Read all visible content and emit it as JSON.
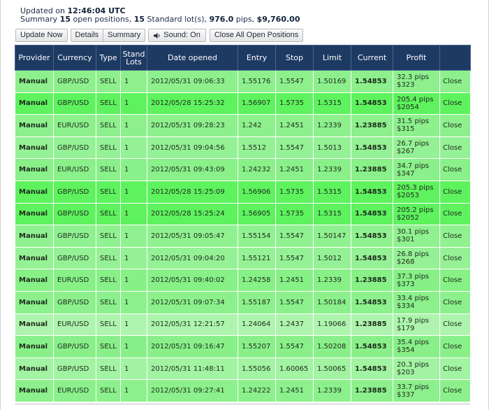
{
  "header": {
    "updated_prefix": "Updated on",
    "updated_time": "12:46:04 UTC",
    "summary_prefix": "Summary",
    "open_positions_count": "15",
    "open_positions_text": "open positions,",
    "standard_lots_count": "15",
    "standard_lots_text": "Standard lot(s),",
    "pips_total": "976.0",
    "pips_text": "pips,",
    "money_total": "$9,760.00"
  },
  "toolbar": {
    "update_now_label": "Update Now",
    "details_label": "Details",
    "summary_label": "Summary",
    "sound_label": "Sound: On",
    "close_all_label": "Close All Open Positions"
  },
  "table": {
    "columns": [
      "Provider",
      "Currency",
      "Type",
      "Stand Lots",
      "Date opened",
      "Entry",
      "Stop",
      "Limit",
      "Current",
      "Profit",
      ""
    ],
    "rows": [
      {
        "provider": "Manual",
        "currency": "GBP/USD",
        "type": "SELL",
        "lots": "1",
        "date": "2012/05/31 09:06:33",
        "entry": "1.55176",
        "stop": "1.5547",
        "limit": "1.50169",
        "current": "1.54853",
        "profit_pips": "32.3 pips",
        "profit_money": "$323",
        "action": "Close",
        "color": "#8df08d"
      },
      {
        "provider": "Manual",
        "currency": "GBP/USD",
        "type": "SELL",
        "lots": "1",
        "date": "2012/05/28 15:25:32",
        "entry": "1.56907",
        "stop": "1.5735",
        "limit": "1.5315",
        "current": "1.54853",
        "profit_pips": "205.4 pips",
        "profit_money": "$2054",
        "action": "Close",
        "color": "#5ef25e"
      },
      {
        "provider": "Manual",
        "currency": "EUR/USD",
        "type": "SELL",
        "lots": "1",
        "date": "2012/05/31 09:28:23",
        "entry": "1.242",
        "stop": "1.2451",
        "limit": "1.2339",
        "current": "1.23885",
        "profit_pips": "31.5 pips",
        "profit_money": "$315",
        "action": "Close",
        "color": "#8df08d"
      },
      {
        "provider": "Manual",
        "currency": "GBP/USD",
        "type": "SELL",
        "lots": "1",
        "date": "2012/05/31 09:04:56",
        "entry": "1.5512",
        "stop": "1.5547",
        "limit": "1.5013",
        "current": "1.54853",
        "profit_pips": "26.7 pips",
        "profit_money": "$267",
        "action": "Close",
        "color": "#95f195"
      },
      {
        "provider": "Manual",
        "currency": "EUR/USD",
        "type": "SELL",
        "lots": "1",
        "date": "2012/05/31 09:43:09",
        "entry": "1.24232",
        "stop": "1.2451",
        "limit": "1.2339",
        "current": "1.23885",
        "profit_pips": "34.7 pips",
        "profit_money": "$347",
        "action": "Close",
        "color": "#8af08a"
      },
      {
        "provider": "Manual",
        "currency": "GBP/USD",
        "type": "SELL",
        "lots": "1",
        "date": "2012/05/28 15:25:09",
        "entry": "1.56906",
        "stop": "1.5735",
        "limit": "1.5315",
        "current": "1.54853",
        "profit_pips": "205.3 pips",
        "profit_money": "$2053",
        "action": "Close",
        "color": "#5ef25e"
      },
      {
        "provider": "Manual",
        "currency": "GBP/USD",
        "type": "SELL",
        "lots": "1",
        "date": "2012/05/28 15:25:24",
        "entry": "1.56905",
        "stop": "1.5735",
        "limit": "1.5315",
        "current": "1.54853",
        "profit_pips": "205.2 pips",
        "profit_money": "$2052",
        "action": "Close",
        "color": "#5ef25e"
      },
      {
        "provider": "Manual",
        "currency": "GBP/USD",
        "type": "SELL",
        "lots": "1",
        "date": "2012/05/31 09:05:47",
        "entry": "1.55154",
        "stop": "1.5547",
        "limit": "1.50147",
        "current": "1.54853",
        "profit_pips": "30.1 pips",
        "profit_money": "$301",
        "action": "Close",
        "color": "#90f190"
      },
      {
        "provider": "Manual",
        "currency": "GBP/USD",
        "type": "SELL",
        "lots": "1",
        "date": "2012/05/31 09:04:20",
        "entry": "1.55121",
        "stop": "1.5547",
        "limit": "1.5012",
        "current": "1.54853",
        "profit_pips": "26.8 pips",
        "profit_money": "$268",
        "action": "Close",
        "color": "#95f195"
      },
      {
        "provider": "Manual",
        "currency": "EUR/USD",
        "type": "SELL",
        "lots": "1",
        "date": "2012/05/31 09:40:02",
        "entry": "1.24258",
        "stop": "1.2451",
        "limit": "1.2339",
        "current": "1.23885",
        "profit_pips": "37.3 pips",
        "profit_money": "$373",
        "action": "Close",
        "color": "#87f087"
      },
      {
        "provider": "Manual",
        "currency": "GBP/USD",
        "type": "SELL",
        "lots": "1",
        "date": "2012/05/31 09:07:34",
        "entry": "1.55187",
        "stop": "1.5547",
        "limit": "1.50184",
        "current": "1.54853",
        "profit_pips": "33.4 pips",
        "profit_money": "$334",
        "action": "Close",
        "color": "#8cf08c"
      },
      {
        "provider": "Manual",
        "currency": "EUR/USD",
        "type": "SELL",
        "lots": "1",
        "date": "2012/05/31 12:21:57",
        "entry": "1.24064",
        "stop": "1.2437",
        "limit": "1.19066",
        "current": "1.23885",
        "profit_pips": "17.9 pips",
        "profit_money": "$179",
        "action": "Close",
        "color": "#aef4ae"
      },
      {
        "provider": "Manual",
        "currency": "GBP/USD",
        "type": "SELL",
        "lots": "1",
        "date": "2012/05/31 09:16:47",
        "entry": "1.55207",
        "stop": "1.5547",
        "limit": "1.50208",
        "current": "1.54853",
        "profit_pips": "35.4 pips",
        "profit_money": "$354",
        "action": "Close",
        "color": "#89f089"
      },
      {
        "provider": "Manual",
        "currency": "GBP/USD",
        "type": "SELL",
        "lots": "1",
        "date": "2012/05/31 11:48:11",
        "entry": "1.55056",
        "stop": "1.60065",
        "limit": "1.50065",
        "current": "1.54853",
        "profit_pips": "20.3 pips",
        "profit_money": "$203",
        "action": "Close",
        "color": "#a2f3a2"
      },
      {
        "provider": "Manual",
        "currency": "EUR/USD",
        "type": "SELL",
        "lots": "1",
        "date": "2012/05/31 09:27:41",
        "entry": "1.24222",
        "stop": "1.2451",
        "limit": "1.2339",
        "current": "1.23885",
        "profit_pips": "33.7 pips",
        "profit_money": "$337",
        "action": "Close",
        "color": "#8cf08c"
      }
    ]
  },
  "colors": {
    "header_bg": "#1d3a62",
    "header_text": "#ffffff",
    "row_text": "#1c2a1c"
  }
}
